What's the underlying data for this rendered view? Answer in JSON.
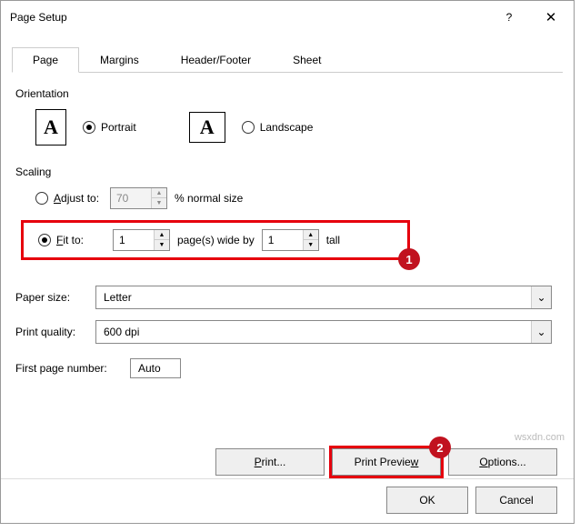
{
  "title": "Page Setup",
  "tabs": {
    "page": "Page",
    "margins": "Margins",
    "headerfooter": "Header/Footer",
    "sheet": "Sheet"
  },
  "orientation": {
    "label": "Orientation",
    "portrait": "Portrait",
    "landscape": "Landscape"
  },
  "scaling": {
    "label": "Scaling",
    "adjust_pre": "A",
    "adjust_post": "djust to:",
    "adjust_value": "70",
    "adjust_suffix": "% normal size",
    "fit_pre": "F",
    "fit_post": "it to:",
    "fit_wide": "1",
    "fit_mid": "page(s) wide by",
    "fit_tall": "1",
    "fit_suffix": "tall"
  },
  "paper": {
    "label": "Paper size:",
    "value": "Letter"
  },
  "quality": {
    "label": "Print quality:",
    "value": "600 dpi"
  },
  "firstpage": {
    "label": "First page number:",
    "value": "Auto"
  },
  "buttons": {
    "print_pre": "P",
    "print_post": "rint...",
    "preview_pre": "Print Previe",
    "preview_post": "w",
    "options_pre": "O",
    "options_post": "ptions...",
    "ok": "OK",
    "cancel": "Cancel"
  },
  "callouts": {
    "one": "1",
    "two": "2"
  },
  "watermark": "wsxdn.com"
}
